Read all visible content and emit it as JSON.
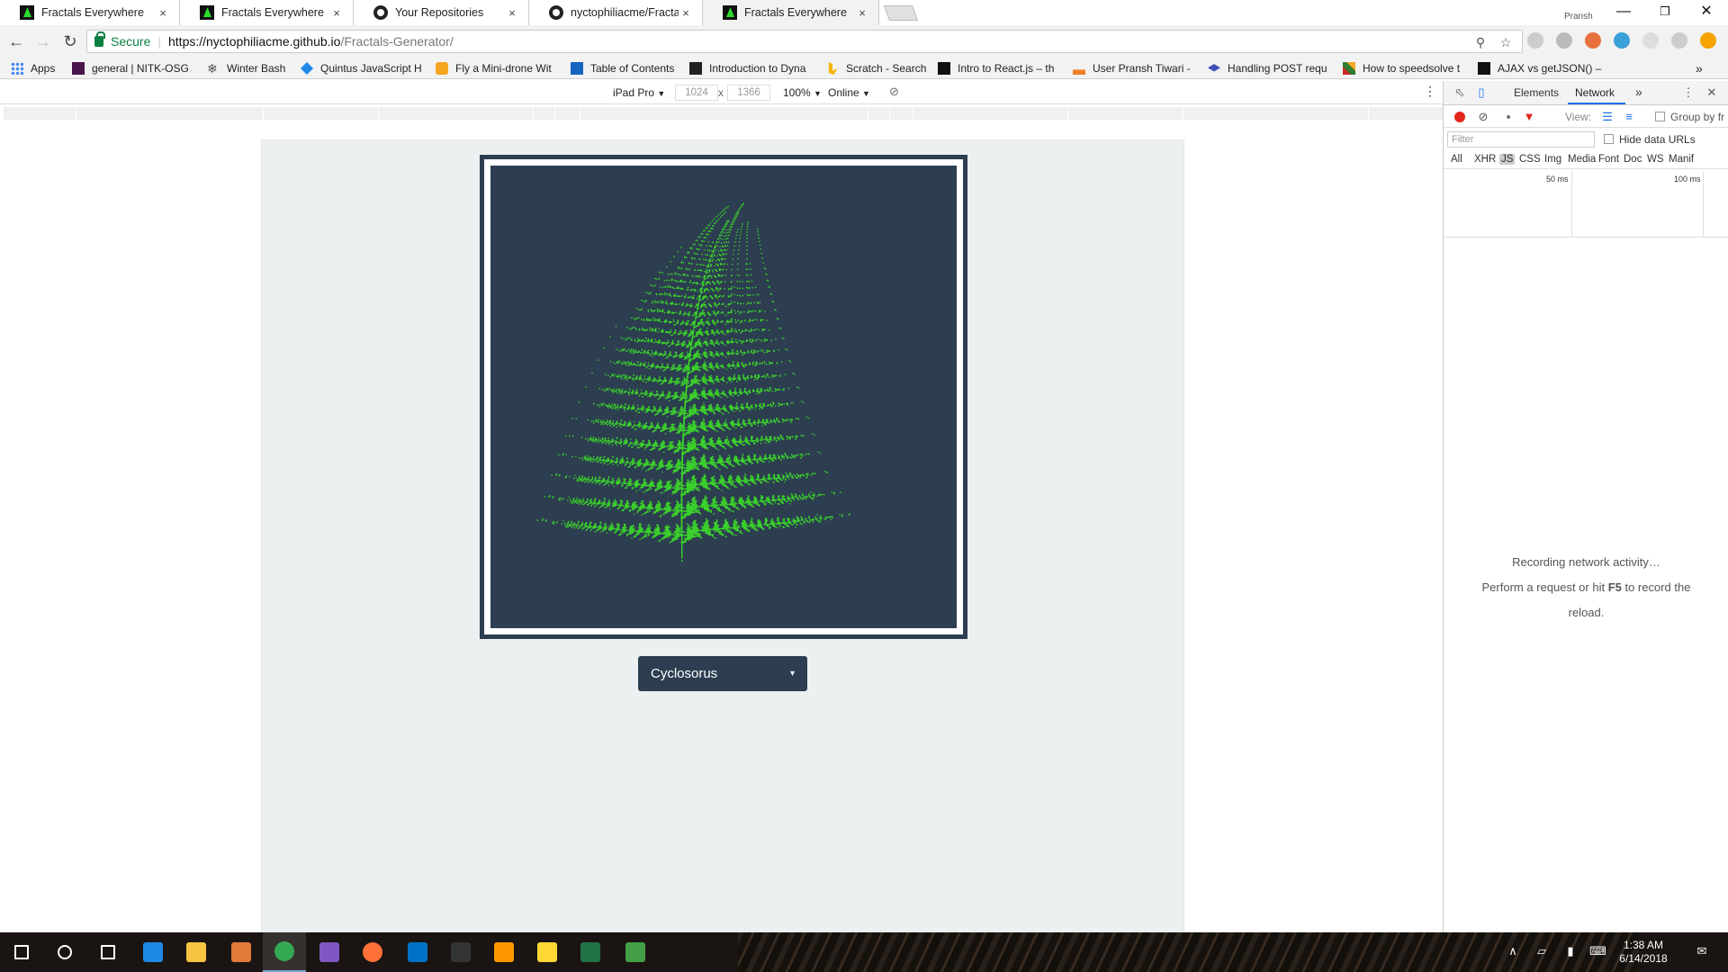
{
  "browser": {
    "tabs": [
      {
        "title": "Fractals Everywhere",
        "favicon": "fractal-icon"
      },
      {
        "title": "Fractals Everywhere",
        "favicon": "fractal-icon"
      },
      {
        "title": "Your Repositories",
        "favicon": "github-icon"
      },
      {
        "title": "nyctophiliacme/Fractals-",
        "favicon": "github-icon"
      },
      {
        "title": "Fractals Everywhere",
        "favicon": "fractal-icon",
        "active": true
      }
    ],
    "close_glyph": "×",
    "profile_name": "Pransh",
    "secure_label": "Secure",
    "url_host": "https://nyctophiliacme.github.io",
    "url_path": "/Fractals-Generator/"
  },
  "bookmarks": [
    {
      "label": "Apps",
      "icon": "apps-grid-icon",
      "color": "#4285f4"
    },
    {
      "label": "general | NITK-OSG",
      "icon": "slack-hash-icon",
      "color": "#4a154b"
    },
    {
      "label": "Winter Bash",
      "icon": "snowflake-icon",
      "color": "#555555"
    },
    {
      "label": "Quintus JavaScript H",
      "icon": "quintus-icon",
      "color": "#1e88e5"
    },
    {
      "label": "Fly a Mini-drone Wit",
      "icon": "drone-icon",
      "color": "#f5a623"
    },
    {
      "label": "Table of Contents",
      "icon": "book-icon",
      "color": "#1565c0"
    },
    {
      "label": "Introduction to Dyna",
      "icon": "h-icon",
      "color": "#222222"
    },
    {
      "label": "Scratch - Search",
      "icon": "bing-icon",
      "color": "#f4b400"
    },
    {
      "label": "Intro to React.js – th",
      "icon": "medium-icon",
      "color": "#111111"
    },
    {
      "label": "User Pransh Tiwari -",
      "icon": "stackoverflow-icon",
      "color": "#f48024"
    },
    {
      "label": "Handling POST requ",
      "icon": "cap-icon",
      "color": "#3f51b5"
    },
    {
      "label": "How to speedsolve t",
      "icon": "cube-icon",
      "color": "#c62828"
    },
    {
      "label": "AJAX vs getJSON() –",
      "icon": "medium-icon",
      "color": "#111111"
    }
  ],
  "device_toolbar": {
    "device": "iPad Pro",
    "width": "1024",
    "height": "1366",
    "times": "x",
    "zoom": "100%",
    "throttle": "Online",
    "caret": "▼"
  },
  "page": {
    "fractal_select_value": "Cyclosorus",
    "caret": "▾",
    "fern_color": "#3bd12b",
    "canvas_color": "#2c3e50"
  },
  "devtools": {
    "tabs": [
      "Elements",
      "Network"
    ],
    "more_glyph": "»",
    "view_label": "View:",
    "group_label": "Group by fr",
    "filter_placeholder": "Filter",
    "hide_data_urls": "Hide data URLs",
    "types": [
      "All",
      "XHR",
      "JS",
      "CSS",
      "Img",
      "Media",
      "Font",
      "Doc",
      "WS",
      "Manif"
    ],
    "timeline_labels": [
      "50 ms",
      "100 ms"
    ],
    "message_line1": "Recording network activity…",
    "message_line2_pre": "Perform a request or hit ",
    "message_key": "F5",
    "message_line2_post": " to record the",
    "message_line3": "reload."
  },
  "taskbar": {
    "time": "1:38 AM",
    "date": "6/14/2018",
    "apps": [
      {
        "name": "start-icon",
        "color": "#ffffff"
      },
      {
        "name": "search-icon",
        "color": "#ffffff"
      },
      {
        "name": "task-view-icon",
        "color": "#ffffff"
      },
      {
        "name": "edge-icon",
        "color": "#1e88e5"
      },
      {
        "name": "file-explorer-icon",
        "color": "#f6c343"
      },
      {
        "name": "sublime-merge-icon",
        "color": "#e07b39"
      },
      {
        "name": "chrome-icon",
        "color": "#34a853"
      },
      {
        "name": "app-icon",
        "color": "#7e57c2"
      },
      {
        "name": "firefox-icon",
        "color": "#ff7139"
      },
      {
        "name": "outlook-icon",
        "color": "#0072c6"
      },
      {
        "name": "terminal-icon",
        "color": "#333333"
      },
      {
        "name": "sublime-text-icon",
        "color": "#ff9800"
      },
      {
        "name": "bulb-icon",
        "color": "#fdd835"
      },
      {
        "name": "excel-icon",
        "color": "#217346"
      },
      {
        "name": "media-icon",
        "color": "#43a047"
      }
    ]
  }
}
